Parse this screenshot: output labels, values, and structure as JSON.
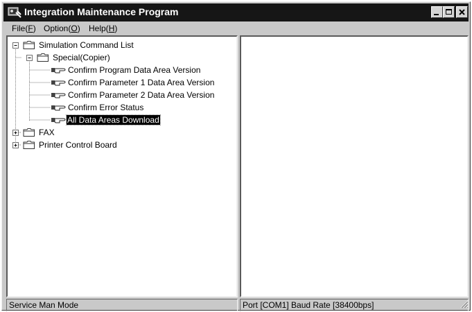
{
  "window": {
    "title": "Integration Maintenance Program"
  },
  "menu": {
    "items": [
      {
        "label": "File(",
        "accel": "F",
        "suffix": ")"
      },
      {
        "label": "Option(",
        "accel": "O",
        "suffix": ")"
      },
      {
        "label": "Help(",
        "accel": "H",
        "suffix": ")"
      }
    ]
  },
  "tree": {
    "root": "Simulation Command List",
    "special": "Special(Copier)",
    "commands": [
      "Confirm Program Data Area Version",
      "Confirm Parameter 1 Data Area Version",
      "Confirm Parameter 2 Data Area Version",
      "Confirm Error Status",
      "All Data Areas Download"
    ],
    "selected_command": "All Data Areas Download",
    "fax": "FAX",
    "printer": "Printer Control Board"
  },
  "status": {
    "mode": "Service Man Mode",
    "port": "Port [COM1] Baud Rate [38400bps]"
  },
  "colors": {
    "titlebar": "#161616",
    "window_bg": "#c9c9c9",
    "selection": "#000000"
  }
}
